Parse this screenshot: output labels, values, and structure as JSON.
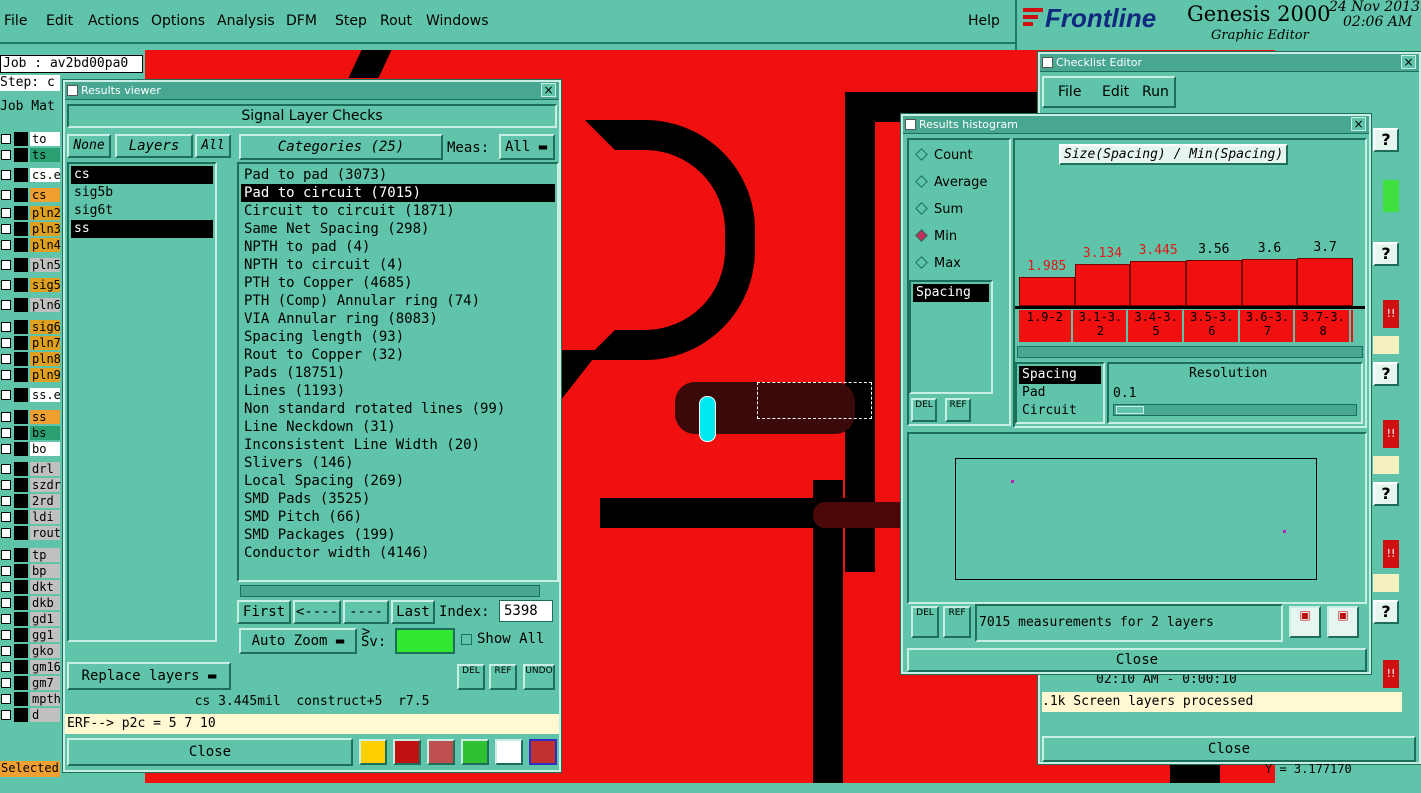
{
  "menubar": {
    "items": [
      "File",
      "Edit",
      "Actions",
      "Options",
      "Analysis",
      "DFM",
      "Step",
      "Rout",
      "Windows"
    ],
    "help": "Help"
  },
  "brand": {
    "company": "Frontline",
    "product": "Genesis 2000",
    "subtitle": "Graphic Editor",
    "date": "24 Nov 2013",
    "time": "02:06 AM"
  },
  "job": {
    "job_label": "Job : av2bd00pa0",
    "step_label": "Step: c",
    "cols": "Job Mat"
  },
  "sidebar": {
    "layers": [
      {
        "name": "to",
        "color": "#ffffff"
      },
      {
        "name": "ts",
        "color": "#2aa070"
      },
      {
        "name": "cs.e",
        "color": "#ffffff"
      },
      {
        "name": "cs",
        "color": "#f0a030"
      },
      {
        "name": "pln2",
        "color": "#e0a020"
      },
      {
        "name": "pln3",
        "color": "#e0a020"
      },
      {
        "name": "pln4",
        "color": "#e0a020"
      },
      {
        "name": "pln5",
        "color": "#c0c0c0"
      },
      {
        "name": "sig5",
        "color": "#e0a020"
      },
      {
        "name": "pln6",
        "color": "#c0c0c0"
      },
      {
        "name": "sig6",
        "color": "#e0a020"
      },
      {
        "name": "pln7",
        "color": "#e0a020"
      },
      {
        "name": "pln8",
        "color": "#e0a020"
      },
      {
        "name": "pln9",
        "color": "#e0a020"
      },
      {
        "name": "ss.e",
        "color": "#ffffff"
      },
      {
        "name": "ss",
        "color": "#f0a030"
      },
      {
        "name": "bs",
        "color": "#2aa070"
      },
      {
        "name": "bo",
        "color": "#ffffff"
      },
      {
        "name": "drl",
        "color": "#c0c0c0"
      },
      {
        "name": "szdr",
        "color": "#c0c0c0"
      },
      {
        "name": "2rd",
        "color": "#c0c0c0"
      },
      {
        "name": "ldi",
        "color": "#c0c0c0"
      },
      {
        "name": "rout",
        "color": "#c0c0c0"
      },
      {
        "name": "tp",
        "color": "#c0c0c0"
      },
      {
        "name": "bp",
        "color": "#c0c0c0"
      },
      {
        "name": "dkt",
        "color": "#c0c0c0"
      },
      {
        "name": "dkb",
        "color": "#c0c0c0"
      },
      {
        "name": "gd1",
        "color": "#c0c0c0"
      },
      {
        "name": "gg1",
        "color": "#c0c0c0"
      },
      {
        "name": "gko",
        "color": "#c0c0c0"
      },
      {
        "name": "gm16",
        "color": "#c0c0c0"
      },
      {
        "name": "gm7",
        "color": "#c0c0c0"
      },
      {
        "name": "mpth",
        "color": "#c0c0c0"
      },
      {
        "name": "d",
        "color": "#c0c0c0"
      }
    ],
    "selected_label": "Selected"
  },
  "results_viewer": {
    "title": "Results viewer",
    "header": "Signal Layer Checks",
    "none_btn": "None",
    "layers_btn": "Layers",
    "all_btn": "All",
    "categories_btn": "Categories (25)",
    "meas_label": "Meas:",
    "meas_value": "All",
    "layers": [
      "cs",
      "sig5b",
      "sig6t",
      "ss"
    ],
    "categories": [
      "Pad to pad (3073)",
      "Pad to circuit (7015)",
      "Circuit to circuit (1871)",
      "Same Net Spacing (298)",
      "NPTH to pad (4)",
      "NPTH to circuit (4)",
      "PTH to Copper (4685)",
      "PTH (Comp) Annular ring (74)",
      "VIA Annular ring (8083)",
      "Spacing length (93)",
      "Rout to Copper (32)",
      "Pads (18751)",
      "Lines (1193)",
      "Non standard rotated lines (99)",
      "Line Neckdown (31)",
      "Inconsistent Line Width (20)",
      "Slivers (146)",
      "Local Spacing (269)",
      "SMD Pads (3525)",
      "SMD Pitch (66)",
      "SMD Packages (199)",
      "Conductor width (4146)"
    ],
    "first": "First",
    "prev": "<----",
    "next": "---->",
    "last": "Last",
    "index_label": "Index:",
    "index_value": "5398",
    "auto_zoom": "Auto Zoom",
    "sv_label": "Sv:",
    "show_all": "Show All",
    "replace_layers": "Replace layers",
    "del": "DEL",
    "ref": "REF",
    "undo": "UNDO",
    "status": "cs 3.445mil  construct+5  r7.5",
    "erf": "ERF--> p2c = 5 7 10",
    "close": "Close"
  },
  "histogram": {
    "title": "Results histogram",
    "radios": [
      "Count",
      "Average",
      "Sum",
      "Min",
      "Max"
    ],
    "selected_radio": "Min",
    "chart_title": "Size(Spacing) / Min(Spacing)",
    "list": [
      "Spacing"
    ],
    "resolution_label": "Resolution",
    "resolution_value": "0.1",
    "types": [
      "Spacing",
      "Pad",
      "Circuit"
    ],
    "measurements": "7015 measurements for 2 layers",
    "del": "DEL",
    "ref": "REF",
    "close": "Close"
  },
  "chart_data": {
    "type": "bar",
    "title": "Size(Spacing) / Min(Spacing)",
    "categories": [
      "1.9-2",
      "3.1-3.2",
      "3.4-3.5",
      "3.5-3.6",
      "3.6-3.7",
      "3.7-3.8"
    ],
    "values": [
      1.985,
      3.134,
      3.445,
      3.56,
      3.6,
      3.7
    ],
    "value_labels": [
      "1.985",
      "3.134",
      "3.445",
      "3.56",
      "3.6",
      "3.7"
    ],
    "highlight_color": "#e01818"
  },
  "checklist": {
    "title": "Checklist Editor",
    "menu": [
      "File",
      "Edit",
      "Run"
    ],
    "time_row": "02:10 AM - 0:00:10",
    "log": ".1k Screen layers processed",
    "close": "Close",
    "bottom": "Y = 3.177170"
  },
  "colors": {
    "bg": "#5fc4a9",
    "copper": "#f01010"
  }
}
